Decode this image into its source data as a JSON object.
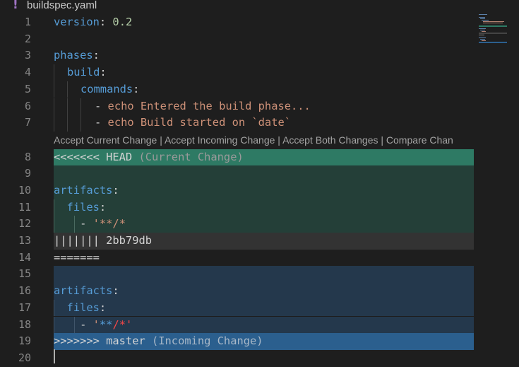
{
  "tab": {
    "icon": "exclamation-icon",
    "filename": "buildspec.yaml"
  },
  "codelens": {
    "accept_current": "Accept Current Change",
    "accept_incoming": "Accept Incoming Change",
    "accept_both": "Accept Both Changes",
    "compare": "Compare Chan",
    "separator": " | "
  },
  "lines": [
    {
      "number": "1"
    },
    {
      "number": "2"
    },
    {
      "number": "3"
    },
    {
      "number": "4"
    },
    {
      "number": "5"
    },
    {
      "number": "6"
    },
    {
      "number": "7"
    },
    {
      "number": "8"
    },
    {
      "number": "9"
    },
    {
      "number": "10"
    },
    {
      "number": "11"
    },
    {
      "number": "12"
    },
    {
      "number": "13"
    },
    {
      "number": "14"
    },
    {
      "number": "15"
    },
    {
      "number": "16"
    },
    {
      "number": "17"
    },
    {
      "number": "18"
    },
    {
      "number": "19"
    },
    {
      "number": "20"
    }
  ],
  "code": {
    "l1_key": "version",
    "l1_colon": ": ",
    "l1_val": "0.2",
    "l3_key": "phases",
    "l4_key": "build",
    "l5_key": "commands",
    "l6_dash": "- ",
    "l6_text": "echo Entered the build phase...",
    "l7_dash": "- ",
    "l7_text": "echo Build started on `date`",
    "l8_marker": "<<<<<<< HEAD",
    "l8_note": " (Current Change)",
    "l10_key": "artifacts",
    "l11_key": "files",
    "l12_dash": "- ",
    "l12_text": "'**/*",
    "l13_marker": "||||||| 2bb79db",
    "l14_marker": "=======",
    "l16_key": "artifacts",
    "l17_key": "files",
    "l18_dash": "- ",
    "l18_q1": "'",
    "l18_stars": "**",
    "l18_rest": "/*'",
    "l19_marker": ">>>>>>> master",
    "l19_note": " (Incoming Change)",
    "colon": ":"
  },
  "colors": {
    "current_header": "#2e7a64",
    "current_body": "#243f38",
    "base_header": "#333333",
    "incoming_body": "#24384c",
    "incoming_header": "#2b5f8e"
  }
}
